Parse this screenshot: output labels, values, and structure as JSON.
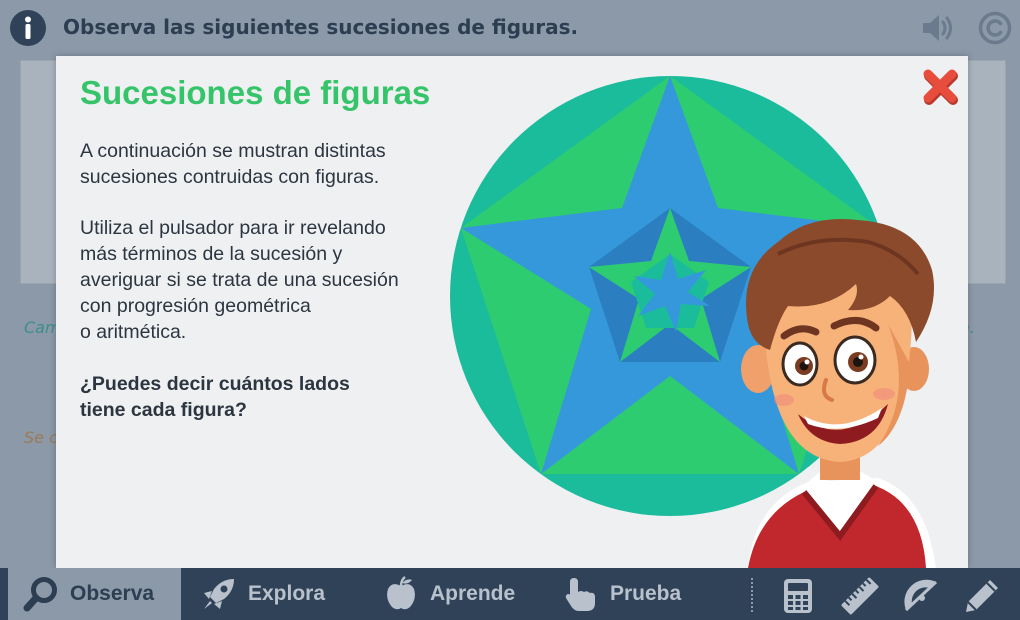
{
  "header": {
    "title": "Observa las siguientes sucesiones de figuras.",
    "icons": {
      "info": "info-icon",
      "sound": "speaker-icon",
      "copyright": "copyright-icon"
    }
  },
  "background": {
    "line1_start": "Cam",
    "line1_end": "a.",
    "line2_start": "Se c"
  },
  "modal": {
    "title": "Sucesiones de figuras",
    "paragraph1": [
      "A continuación se mustran distintas",
      "sucesiones contruidas con figuras."
    ],
    "paragraph2": [
      "Utiliza el pulsador para ir revelando",
      "más términos de la sucesión y",
      "averiguar si se trata de una sucesión",
      "con progresión geométrica",
      "o aritmética."
    ],
    "question": [
      "¿Puedes decir cuántos lados",
      "tiene cada figura?"
    ],
    "close_icon": "close-icon",
    "colors": {
      "title": "#36c46a",
      "close": "#e84c3d",
      "teal": "#1bbc9b",
      "green": "#2ecc71",
      "blue": "#3498db"
    }
  },
  "bottom_nav": {
    "items": [
      {
        "label": "Observa",
        "icon": "magnifier-icon",
        "active": true
      },
      {
        "label": "Explora",
        "icon": "rocket-icon",
        "active": false
      },
      {
        "label": "Aprende",
        "icon": "apple-icon",
        "active": false
      },
      {
        "label": "Prueba",
        "icon": "hand-pointer-icon",
        "active": false
      }
    ],
    "tools": [
      "calculator-icon",
      "ruler-icon",
      "protractor-icon",
      "pencil-icon"
    ]
  }
}
